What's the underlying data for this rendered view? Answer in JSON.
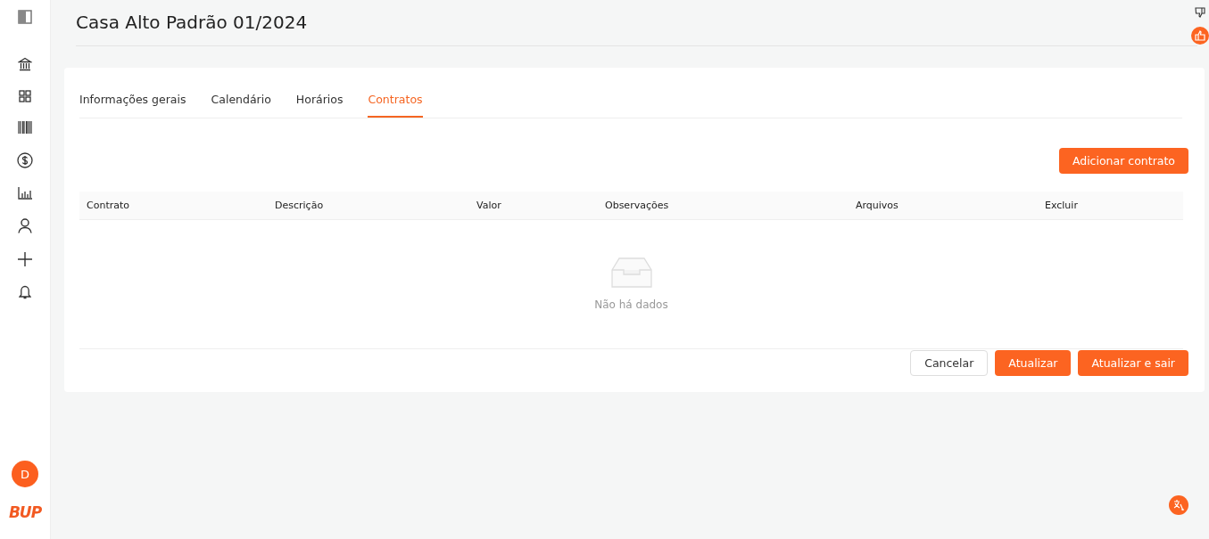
{
  "page": {
    "title": "Casa Alto Padrão 01/2024"
  },
  "sidebar": {
    "avatar": "D",
    "logo": "BUP"
  },
  "tabs": [
    {
      "label": "Informações gerais",
      "selected": false
    },
    {
      "label": "Calendário",
      "selected": false
    },
    {
      "label": "Horários",
      "selected": false
    },
    {
      "label": "Contratos",
      "selected": true
    }
  ],
  "add_button": "Adicionar contrato",
  "table": {
    "columns": [
      "Contrato",
      "Descrição",
      "Valor",
      "Observações",
      "Arquivos",
      "Excluir"
    ],
    "empty_text": "Não há dados"
  },
  "footer_buttons": [
    {
      "label": "Cancelar",
      "kind": "default"
    },
    {
      "label": "Atualizar",
      "kind": "primary"
    },
    {
      "label": "Atualizar e sair",
      "kind": "primary"
    }
  ]
}
